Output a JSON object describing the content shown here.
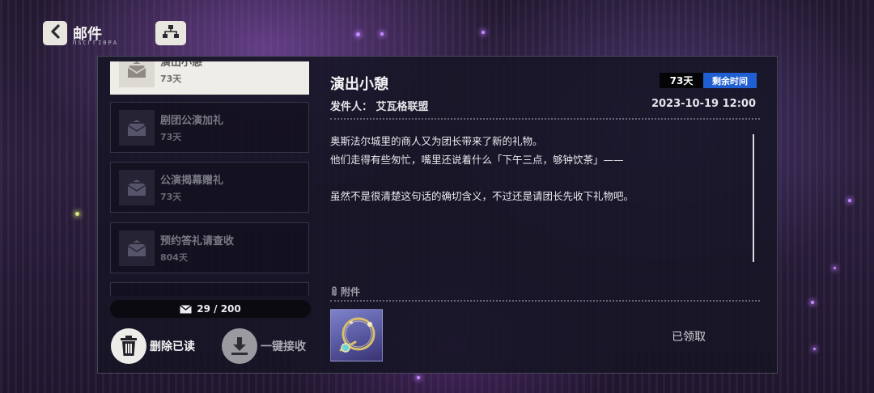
{
  "header": {
    "title": "邮件",
    "subtitle": "ΠЅϹΓΓΙΘΡΑ"
  },
  "mail_list": [
    {
      "title": "演出小憩",
      "days": "73天",
      "selected": true
    },
    {
      "title": "剧团公演加礼",
      "days": "73天",
      "selected": false
    },
    {
      "title": "公演揭幕赠礼",
      "days": "73天",
      "selected": false
    },
    {
      "title": "预约答礼请查收",
      "days": "804天",
      "selected": false
    }
  ],
  "mail_count": "29 / 200",
  "actions": {
    "delete_read": "删除已读",
    "receive_all": "一键接收"
  },
  "detail": {
    "title": "演出小憩",
    "days_left": "73天",
    "remaining_label": "剩余时间",
    "sender": "发件人： 艾瓦格联盟",
    "date": "2023-10-19 12:00",
    "body": [
      "奥斯法尔城里的商人又为团长带来了新的礼物。",
      "他们走得有些匆忙，嘴里还说着什么「下午三点，够钟饮茶」——",
      "虽然不是很清楚这句话的确切含义，不过还是请团长先收下礼物吧。"
    ],
    "attachment_label": "附件",
    "claimed_status": "已领取"
  },
  "colors": {
    "accent_blue": "#1f5fd1",
    "selected_item": "#efede8"
  }
}
